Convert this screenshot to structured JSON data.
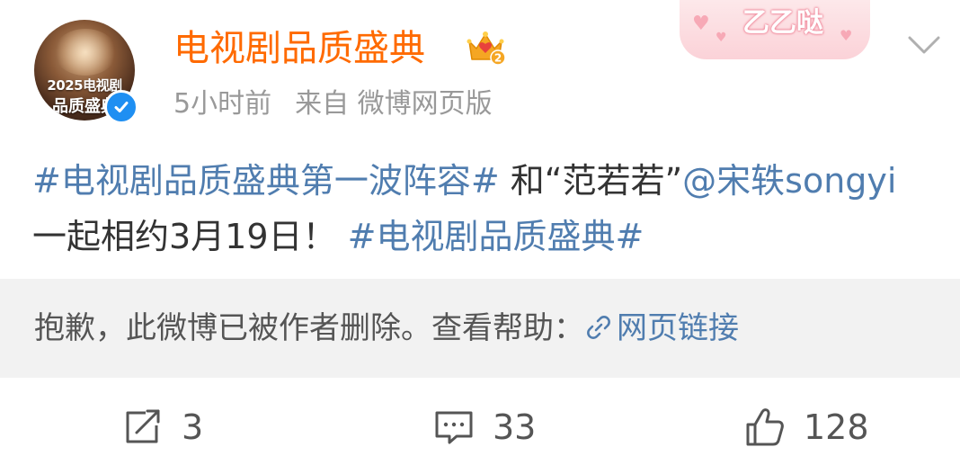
{
  "post": {
    "avatar": {
      "line1": "2025电视剧",
      "line2": "品质盛典"
    },
    "username": "电视剧品质盛典",
    "time": "5小时前",
    "source": "来自 微博网页版",
    "sticker_text": "乙乙哒",
    "content": {
      "hashtag_1": "#电视剧品质盛典第一波阵容#",
      "text_1": " 和“范若若”",
      "mention": "@宋轶songyi",
      "text_2": " 一起相约3月19日！ ",
      "hashtag_2": "#电视剧品质盛典#"
    },
    "notice": {
      "text": "抱歉，此微博已被作者删除。查看帮助：",
      "link_label": "网页链接"
    },
    "actions": {
      "repost_count": "3",
      "comment_count": "33",
      "like_count": "128"
    }
  },
  "colors": {
    "username": "#ff6a00",
    "link": "#507daf",
    "meta": "#999999",
    "notice_bg": "#f2f2f2",
    "verified": "#1f8ff2"
  },
  "icons": {
    "verified": "verified-check-icon",
    "member": "crown-icon",
    "menu": "chevron-down-icon",
    "notice_link": "link-icon",
    "repost": "repost-icon",
    "comment": "comment-icon",
    "like": "thumbs-up-icon"
  }
}
